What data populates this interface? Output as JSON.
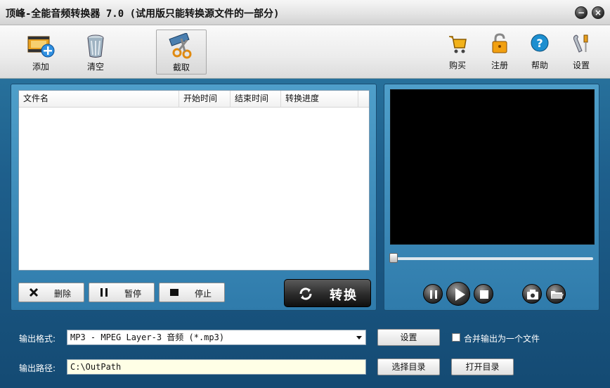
{
  "window": {
    "title": "顶峰-全能音频转换器 7.0 (试用版只能转换源文件的一部分)",
    "minimize": "−",
    "close": "×"
  },
  "toolbar": {
    "add_label": "添加",
    "clear_label": "清空",
    "cut_label": "截取",
    "buy_label": "购买",
    "register_label": "注册",
    "help_label": "帮助",
    "settings_label": "设置"
  },
  "filelist": {
    "columns": [
      "文件名",
      "开始时间",
      "结束时间",
      "转换进度"
    ],
    "rows": []
  },
  "controls": {
    "delete_label": "删除",
    "pause_label": "暂停",
    "stop_label": "停止",
    "convert_label": "转换"
  },
  "player": {
    "progress": 0
  },
  "output": {
    "format_label": "输出格式:",
    "format_value": "MP3 - MPEG Layer-3 音频 (*.mp3)",
    "format_settings_label": "设置",
    "merge_label": "合并输出为一个文件",
    "merge_checked": false,
    "path_label": "输出路径:",
    "path_value": "C:\\OutPath",
    "choose_dir_label": "选择目录",
    "open_dir_label": "打开目录"
  }
}
